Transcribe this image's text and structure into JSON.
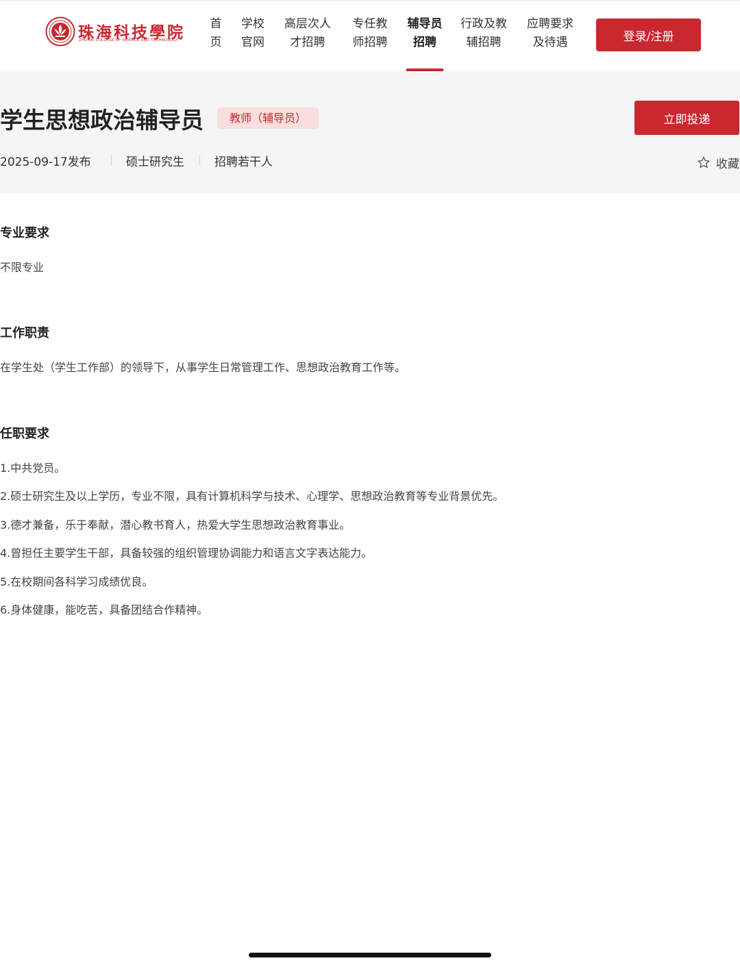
{
  "header": {
    "logo": {
      "name": "珠海科技學院",
      "subtitle": "ZHUHAI COLLEGE OF SCIENCE AND TECHNOLOGY",
      "icon": "lotus-seal-icon"
    },
    "nav": [
      {
        "line1": "首",
        "line2": "页"
      },
      {
        "line1": "学校",
        "line2": "官网"
      },
      {
        "line1": "高层次人",
        "line2": "才招聘"
      },
      {
        "line1": "专任教",
        "line2": "师招聘"
      },
      {
        "line1": "辅导员",
        "line2": "招聘"
      },
      {
        "line1": "行政及教",
        "line2": "辅招聘"
      },
      {
        "line1": "应聘要求",
        "line2": "及待遇"
      }
    ],
    "active_nav_index": 4,
    "login_label": "登录/注册"
  },
  "job": {
    "title": "学生思想政治辅导员",
    "tag": "教师（辅导员）",
    "apply_label": "立即投递",
    "posted": "2025-09-17发布",
    "education": "硕士研究生",
    "headcount": "招聘若干人",
    "favorite_label": "收藏"
  },
  "sections": {
    "major": {
      "title": "专业要求",
      "text": "不限专业"
    },
    "duties": {
      "title": "工作职责",
      "text": "在学生处（学生工作部）的领导下，从事学生日常管理工作、思想政治教育工作等。"
    },
    "requirements": {
      "title": "任职要求",
      "items": [
        "1.中共党员。",
        "2.硕士研究生及以上学历，专业不限，具有计算机科学与技术、心理学、思想政治教育等专业背景优先。",
        "3.德才兼备，乐于奉献，潜心教书育人，热爱大学生思想政治教育事业。",
        "4.曾担任主要学生干部，具备较强的组织管理协调能力和语言文字表达能力。",
        "5.在校期间各科学习成绩优良。",
        "6.身体健康，能吃苦，具备团结合作精神。"
      ]
    }
  },
  "colors": {
    "brand": "#c8282e",
    "tag_bg": "#f8dede",
    "band_bg": "#f5f5f6"
  }
}
